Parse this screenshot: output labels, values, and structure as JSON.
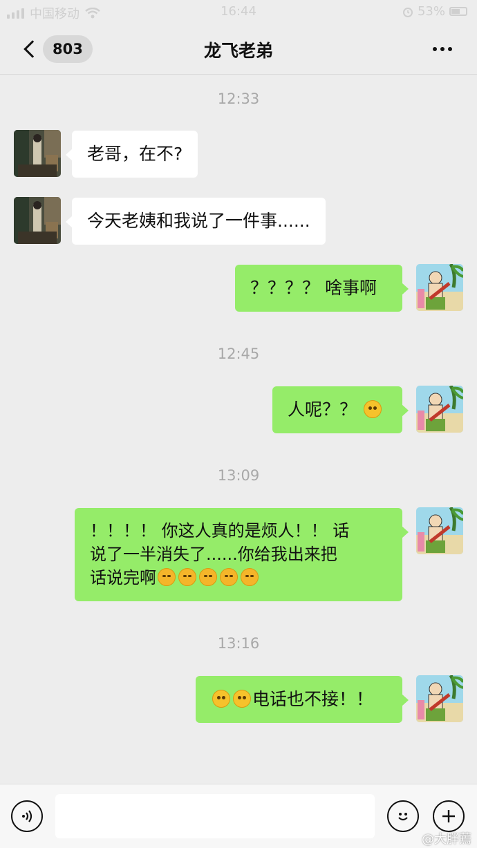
{
  "status_bar": {
    "carrier": "中国移动",
    "time": "16:44",
    "battery": "53%"
  },
  "nav": {
    "unread_count": "803",
    "title": "龙飞老弟"
  },
  "messages": [
    {
      "type": "time",
      "text": "12:33"
    },
    {
      "type": "msg",
      "side": "left",
      "text": "老哥，在不?"
    },
    {
      "type": "msg",
      "side": "left",
      "text": "今天老姨和我说了一件事......"
    },
    {
      "type": "msg",
      "side": "right",
      "text": "？？？？ 啥事啊"
    },
    {
      "type": "time",
      "text": "12:45"
    },
    {
      "type": "msg",
      "side": "right",
      "text": "人呢？？",
      "emoji_after": [
        "dizzy-face"
      ]
    },
    {
      "type": "time",
      "text": "13:09"
    },
    {
      "type": "msg",
      "side": "right",
      "lines": [
        "！！！！ 你这人真的是烦人！！ 话",
        "说了一半消失了......你给我出来把",
        "话说完啊"
      ],
      "emoji_after": [
        "crying-laughing-face",
        "crying-laughing-face",
        "crying-laughing-face",
        "crying-laughing-face",
        "crying-laughing-face"
      ]
    },
    {
      "type": "time",
      "text": "13:16"
    },
    {
      "type": "msg",
      "side": "right",
      "emoji_before": [
        "smiling-face",
        "smiling-face"
      ],
      "text": "电话也不接！！"
    }
  ],
  "input": {
    "placeholder": ""
  },
  "watermark": "@大胖蔫",
  "icons": {
    "voice": "voice-icon",
    "emoji": "emoji-icon",
    "add": "plus-icon",
    "back": "chevron-left-icon",
    "more": "more-dots-icon"
  },
  "colors": {
    "background": "#ededed",
    "bubble_right": "#95ec69",
    "bubble_left": "#ffffff",
    "timestamp": "#a8a8a8"
  }
}
